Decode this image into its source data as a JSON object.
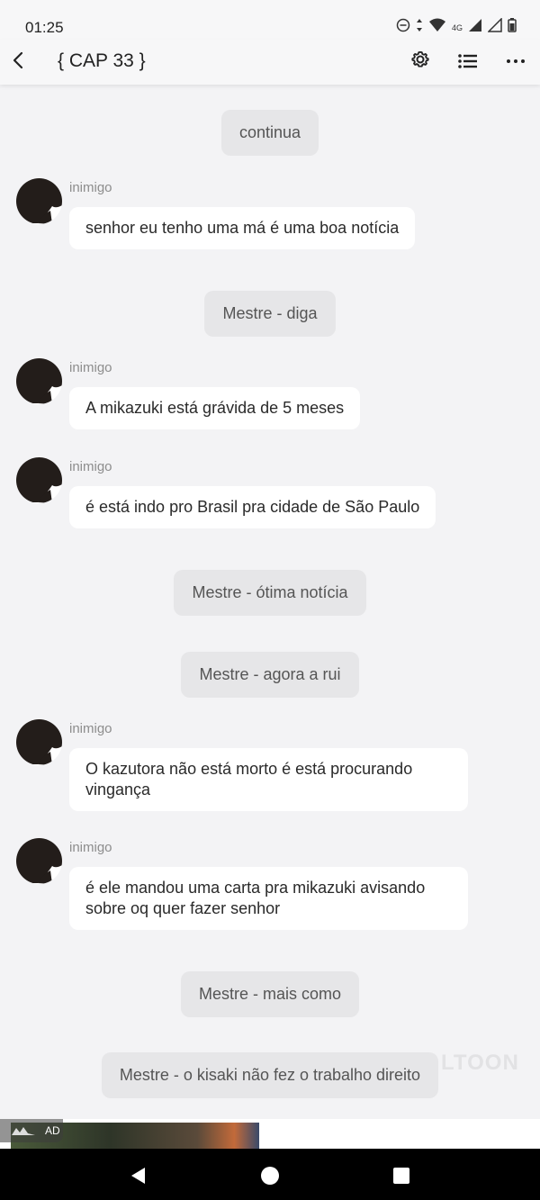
{
  "status": {
    "time": "01:25",
    "network": "4G"
  },
  "header": {
    "title": "{ CAP 33 }",
    "icons": [
      "back-arrow-icon",
      "gear-icon",
      "list-icon",
      "more-icon"
    ]
  },
  "messages": [
    {
      "type": "center",
      "text": "continua"
    },
    {
      "type": "left",
      "sender": "inimigo",
      "text": "senhor eu tenho uma má é uma boa notícia"
    },
    {
      "type": "center",
      "text": "Mestre - diga"
    },
    {
      "type": "left",
      "sender": "inimigo",
      "text": "A mikazuki está grávida de 5 meses"
    },
    {
      "type": "left",
      "sender": "inimigo",
      "text": "é está indo pro Brasil pra cidade de São Paulo"
    },
    {
      "type": "center",
      "text": "Mestre - ótima notícia"
    },
    {
      "type": "center",
      "text": "Mestre - agora a rui"
    },
    {
      "type": "left",
      "sender": "inimigo",
      "text": "O kazutora não está morto é está procurando vingança"
    },
    {
      "type": "left",
      "sender": "inimigo",
      "text": "é ele mandou uma carta pra mikazuki avisando sobre oq quer fazer senhor"
    },
    {
      "type": "center",
      "text": "Mestre - mais como"
    },
    {
      "type": "center",
      "text": "Mestre - o kisaki não fez o trabalho direito"
    }
  ],
  "watermark": "LTOON",
  "ad": {
    "label": "AD"
  },
  "colors": {
    "background": "#f3f3f5",
    "bubble": "#ffffff",
    "center_pill": "#e6e6e8",
    "sender": "#8d8d8d"
  }
}
